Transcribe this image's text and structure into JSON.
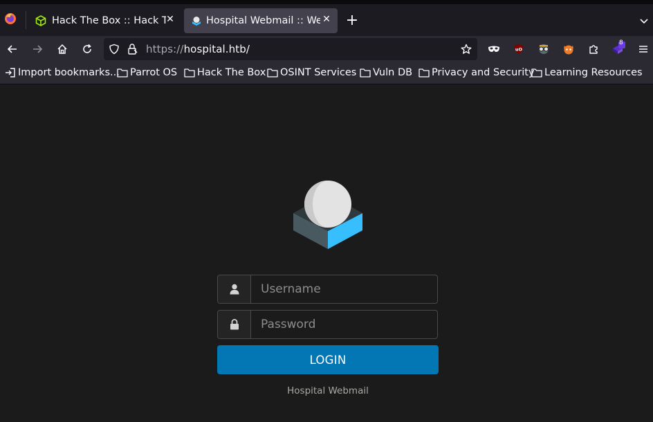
{
  "browser": {
    "tabs": [
      {
        "title": "Hack The Box :: Hack The",
        "icon": "htb-cube-icon",
        "active": false
      },
      {
        "title": "Hospital Webmail :: Welc",
        "icon": "roundcube-icon",
        "active": true
      }
    ],
    "url": {
      "protocol": "https://",
      "host": "hospital.htb/"
    },
    "bookmarks": [
      {
        "label": "Import bookmarks...",
        "icon": "import-icon"
      },
      {
        "label": "Parrot OS",
        "icon": "folder-icon"
      },
      {
        "label": "Hack The Box",
        "icon": "folder-icon"
      },
      {
        "label": "OSINT Services",
        "icon": "folder-icon"
      },
      {
        "label": "Vuln DB",
        "icon": "folder-icon"
      },
      {
        "label": "Privacy and Security",
        "icon": "folder-icon"
      },
      {
        "label": "Learning Resources",
        "icon": "folder-icon"
      }
    ],
    "extension_badge": "8"
  },
  "login": {
    "username_placeholder": "Username",
    "password_placeholder": "Password",
    "login_label": "LOGIN",
    "footer": "Hospital Webmail"
  },
  "colors": {
    "accent": "#0277b3",
    "background": "#1b1b1c",
    "logo_blue": "#37beff",
    "logo_dark": "#485a60"
  }
}
